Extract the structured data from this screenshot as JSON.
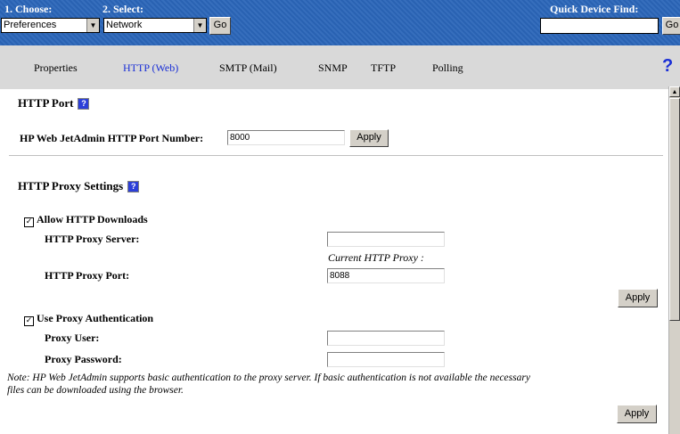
{
  "topbar": {
    "choose_label": "1. Choose:",
    "select_label": "2. Select:",
    "quick_find_label": "Quick Device Find:",
    "choose_value": "Preferences",
    "select_value": "Network",
    "go_label": "Go",
    "quick_find_value": "",
    "quick_go_label": "Go"
  },
  "tabs": [
    "Properties",
    "HTTP (Web)",
    "SMTP (Mail)",
    "SNMP",
    "TFTP",
    "Polling"
  ],
  "active_tab": "HTTP (Web)",
  "http_port": {
    "heading": "HTTP Port",
    "field_label": "HP Web JetAdmin HTTP Port Number:",
    "value": "8000",
    "apply_label": "Apply"
  },
  "proxy": {
    "heading": "HTTP Proxy Settings",
    "allow_label": "Allow HTTP Downloads",
    "allow_checked": true,
    "server_label": "HTTP Proxy Server:",
    "server_value": "",
    "current_proxy": "Current HTTP Proxy :",
    "port_label": "HTTP Proxy Port:",
    "port_value": "8088",
    "apply_label": "Apply",
    "auth_label": "Use Proxy Authentication",
    "auth_checked": true,
    "user_label": "Proxy User:",
    "user_value": "",
    "password_label": "Proxy Password:",
    "password_value": "",
    "note": "Note: HP Web JetAdmin supports basic authentication to the proxy server. If basic authentication is not available the necessary",
    "note2": "files can be downloaded using the browser.",
    "apply2_label": "Apply"
  },
  "colors": {
    "topbar": "#2b66b9",
    "tabbar": "#d9d9d9",
    "active_tab": "#1a2fd6"
  }
}
